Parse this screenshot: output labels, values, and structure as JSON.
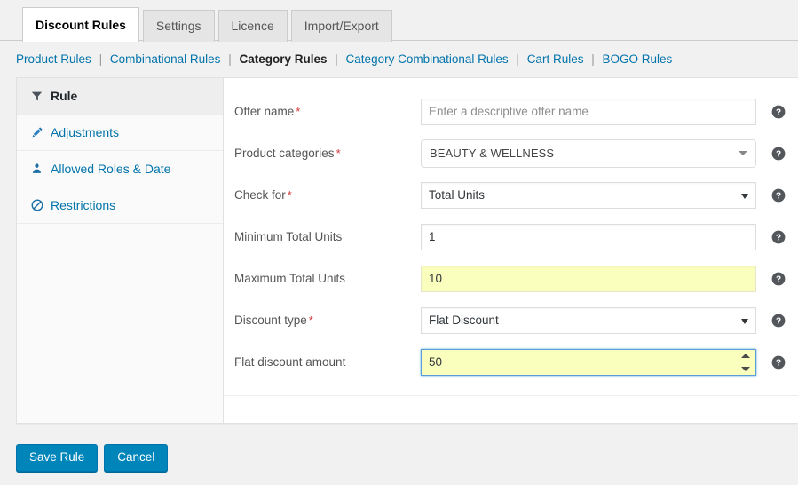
{
  "tabs": [
    {
      "label": "Discount Rules",
      "active": true
    },
    {
      "label": "Settings",
      "active": false
    },
    {
      "label": "Licence",
      "active": false
    },
    {
      "label": "Import/Export",
      "active": false
    }
  ],
  "subnav": {
    "separator": "|",
    "items": [
      {
        "label": "Product Rules",
        "current": false
      },
      {
        "label": "Combinational Rules",
        "current": false
      },
      {
        "label": "Category Rules",
        "current": true
      },
      {
        "label": "Category Combinational Rules",
        "current": false
      },
      {
        "label": "Cart Rules",
        "current": false
      },
      {
        "label": "BOGO Rules",
        "current": false
      }
    ]
  },
  "sidebar": {
    "items": [
      {
        "label": "Rule",
        "icon": "funnel-icon",
        "active": true
      },
      {
        "label": "Adjustments",
        "icon": "pencil-icon",
        "active": false
      },
      {
        "label": "Allowed Roles & Date",
        "icon": "user-icon",
        "active": false
      },
      {
        "label": "Restrictions",
        "icon": "ban-icon",
        "active": false
      }
    ]
  },
  "form": {
    "required_marker": "*",
    "help_icon": "help-icon",
    "fields": {
      "offer_name": {
        "label": "Offer name",
        "required": true,
        "placeholder": "Enter a descriptive offer name",
        "value": ""
      },
      "product_categories": {
        "label": "Product categories",
        "required": true,
        "value": "BEAUTY & WELLNESS"
      },
      "check_for": {
        "label": "Check for",
        "required": true,
        "value": "Total Units"
      },
      "minimum_total_units": {
        "label": "Minimum Total Units",
        "required": false,
        "value": "1"
      },
      "maximum_total_units": {
        "label": "Maximum Total Units",
        "required": false,
        "value": "10"
      },
      "discount_type": {
        "label": "Discount type",
        "required": true,
        "value": "Flat Discount"
      },
      "flat_discount_amount": {
        "label": "Flat discount amount",
        "required": false,
        "value": "50"
      }
    }
  },
  "footer": {
    "save_label": "Save Rule",
    "cancel_label": "Cancel"
  },
  "colors": {
    "accent": "#0073aa",
    "button": "#0085ba",
    "required": "#d63638",
    "autofill": "#faffbd",
    "focus_border": "#5b9dd9",
    "page_bg": "#f1f1f1"
  }
}
